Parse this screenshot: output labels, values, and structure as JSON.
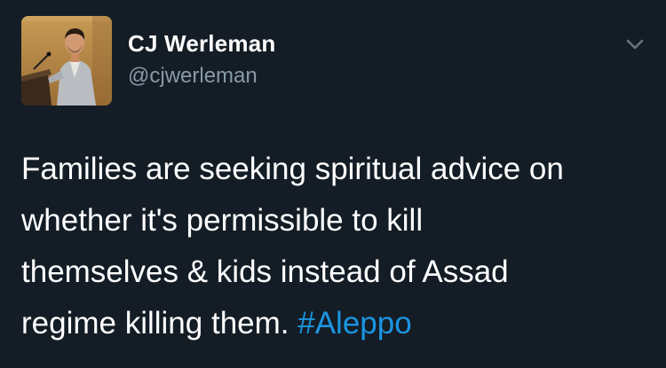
{
  "author": {
    "display_name": "CJ Werleman",
    "handle": "@cjwerleman",
    "avatar_icon": "profile-photo-speaker-at-podium"
  },
  "menu": {
    "icon": "chevron-down-icon"
  },
  "tweet": {
    "lines": [
      "Families are seeking spiritual advice on",
      "whether it's permissible to kill",
      "themselves & kids instead of Assad",
      "regime killing them. "
    ],
    "hashtag": "#Aleppo"
  },
  "colors": {
    "background": "#141d26",
    "text": "#ffffff",
    "handle": "#8899a6",
    "link": "#1b95e0"
  }
}
